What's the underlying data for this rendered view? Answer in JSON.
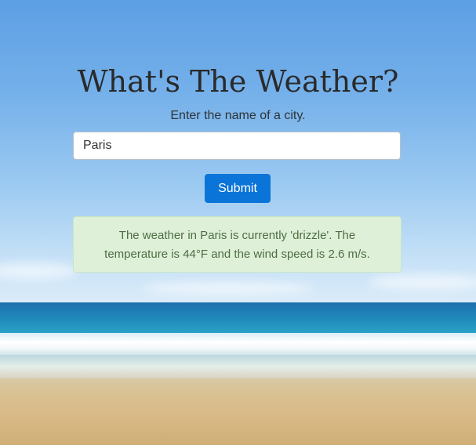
{
  "page": {
    "title": "What's The Weather?",
    "prompt": "Enter the name of a city."
  },
  "form": {
    "city_value": "Paris",
    "submit_label": "Submit"
  },
  "result": {
    "message": "The weather in Paris is currently 'drizzle'. The temperature is 44°F and the wind speed is 2.6 m/s."
  },
  "colors": {
    "button": "#0b74d8",
    "alert_background": "#dff0d8",
    "alert_text": "#4d6e44"
  }
}
